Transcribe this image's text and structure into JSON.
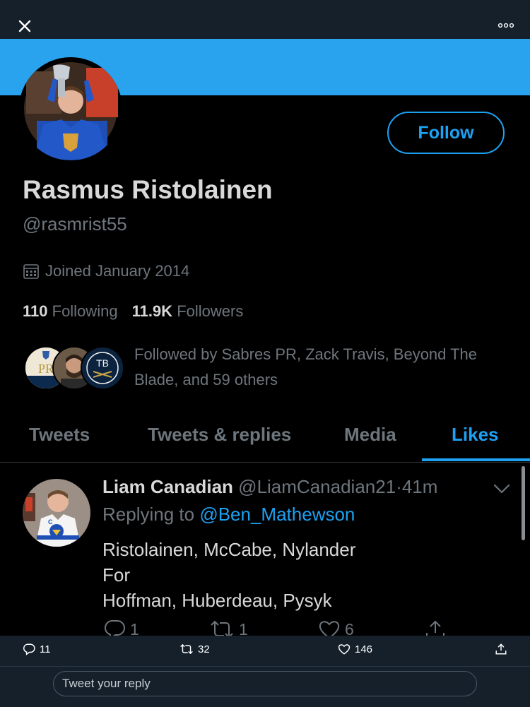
{
  "profile": {
    "display_name": "Rasmus Ristolainen",
    "handle": "@rasmrist55",
    "joined": "Joined January 2014",
    "following_count": "110",
    "following_label": "Following",
    "followers_count": "11.9K",
    "followers_label": "Followers",
    "followed_by": "Followed by Sabres PR, Zack Travis, Beyond The Blade, and 59 others",
    "follow_label": "Follow",
    "follower_avatar_1_text": "PR",
    "follower_avatar_3_text": "TB"
  },
  "tabs": [
    {
      "label": "Tweets",
      "active": false
    },
    {
      "label": "Tweets & replies",
      "active": false
    },
    {
      "label": "Media",
      "active": false
    },
    {
      "label": "Likes",
      "active": true
    }
  ],
  "tweet": {
    "author": "Liam Canadian",
    "handle": "@LiamCanadian21",
    "separator": "·",
    "time": "41m",
    "replying_prefix": "Replying to",
    "replying_to": "@Ben_Mathewson",
    "lines": [
      "Ristolainen, McCabe, Nylander",
      "For",
      "Hoffman, Huberdeau, Pysyk"
    ],
    "reply_count": "1",
    "retweet_count": "1",
    "like_count": "6"
  },
  "bottom_bar": {
    "reply_count": "11",
    "retweet_count": "32",
    "like_count": "146"
  },
  "reply_box": {
    "placeholder": "Tweet your reply"
  },
  "icons": {
    "close": "close-icon",
    "more": "more-icon",
    "calendar": "calendar-icon",
    "caret": "chevron-down-icon",
    "reply": "reply-icon",
    "retweet": "retweet-icon",
    "like": "heart-icon",
    "share": "share-icon"
  },
  "colors": {
    "accent": "#1da1f2",
    "banner": "#2aa3ef",
    "background": "#000000",
    "chrome": "#15202b",
    "muted_text": "#6e767d"
  }
}
